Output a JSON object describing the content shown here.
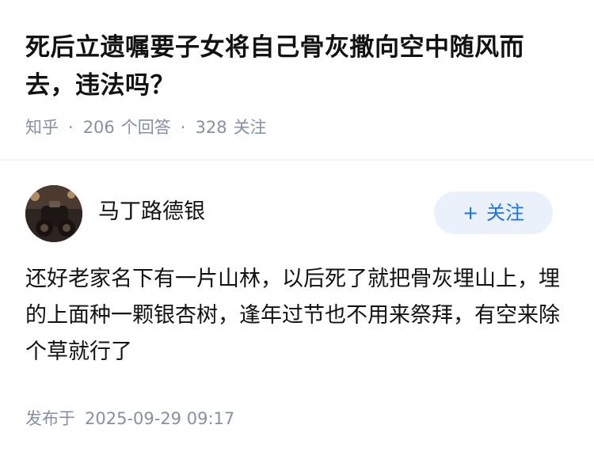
{
  "question": {
    "title": "死后立遗嘱要子女将自己骨灰撒向空中随风而去，违法吗？",
    "source": "知乎",
    "answer_count": "206",
    "answer_label": "个回答",
    "follower_count": "328",
    "follower_label": "关注"
  },
  "answer": {
    "author_name": "马丁路德银",
    "follow_plus": "+",
    "follow_label": "关注",
    "content": "还好老家名下有一片山林，以后死了就把骨灰埋山上，埋的上面种一颗银杏树，逢年过节也不用来祭拜，有空来除个草就行了",
    "publish_label": "发布于",
    "publish_time": "2025-09-29 09:17"
  }
}
